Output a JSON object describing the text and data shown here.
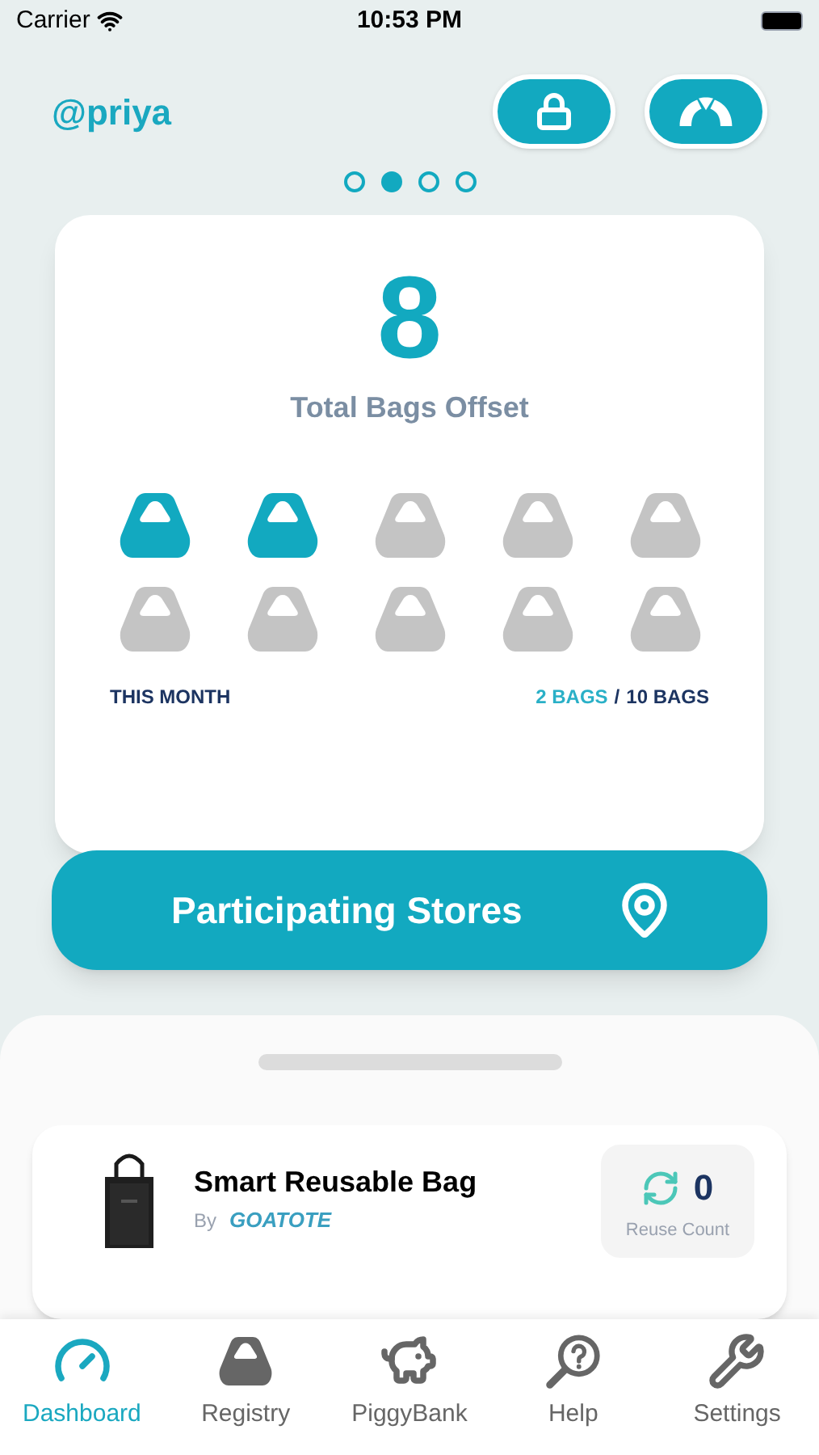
{
  "status_bar": {
    "carrier": "Carrier",
    "time": "10:53 PM"
  },
  "header": {
    "username": "@priya"
  },
  "pager": [
    {
      "selected": false
    },
    {
      "selected": true
    },
    {
      "selected": false
    },
    {
      "selected": false
    }
  ],
  "summary": {
    "total": "8",
    "label": "Total Bags Offset",
    "bags": [
      {
        "filled": true
      },
      {
        "filled": true
      },
      {
        "filled": false
      },
      {
        "filled": false
      },
      {
        "filled": false
      },
      {
        "filled": false
      },
      {
        "filled": false
      },
      {
        "filled": false
      },
      {
        "filled": false
      },
      {
        "filled": false
      }
    ],
    "period": "THIS MONTH",
    "used": "2 BAGS",
    "separator": "/",
    "limit": "10 BAGS"
  },
  "stores_button": {
    "label": "Participating Stores"
  },
  "product": {
    "name": "Smart Reusable Bag",
    "by": "By",
    "brand": "GOATOTE",
    "reuse_count": "0",
    "reuse_label": "Reuse Count"
  },
  "tabs": [
    {
      "label": "Dashboard",
      "kind": "gauge",
      "selected": true
    },
    {
      "label": "Registry",
      "kind": "bag",
      "selected": false
    },
    {
      "label": "PiggyBank",
      "kind": "piggy",
      "selected": false
    },
    {
      "label": "Help",
      "kind": "help",
      "selected": false
    },
    {
      "label": "Settings",
      "kind": "tools",
      "selected": false
    }
  ]
}
